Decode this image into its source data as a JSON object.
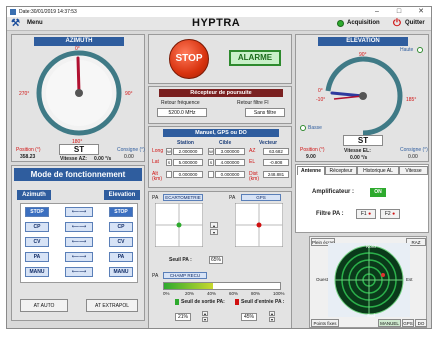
{
  "window": {
    "title": "Date:30/01/2019 14:37:53",
    "min": "–",
    "max": "□",
    "close": "✕"
  },
  "toolbar": {
    "menu": "Menu",
    "app_title": "HYPTRA",
    "acquisition": "Acquisition",
    "quit": "Quitter"
  },
  "azimuth": {
    "title": "AZIMUTH",
    "dial_0": "0°",
    "dial_90": "90°",
    "dial_180": "180°",
    "dial_270": "270°",
    "status": "ST",
    "position_label": "Position (°)",
    "position": "358.23",
    "speed_label": "Vitesse AZ:",
    "speed": "0.00 °/s",
    "setpoint_label": "Consigne (°)",
    "setpoint": "0.00"
  },
  "stop": {
    "label": "STOP",
    "alarm": "ALARME"
  },
  "receiver": {
    "title": "Récepteur de poursuite",
    "freq_label": "Retour fréquence",
    "freq": "5200.0 MHz",
    "filter_label": "Retour filtre FI",
    "filter": "Sans filtre"
  },
  "manual": {
    "title": "Manuel, GPS ou DO",
    "col_station": "Station",
    "col_cible": "Cible",
    "col_vecteur": "Vecteur",
    "rows": [
      {
        "label": "Long",
        "s_dir": "W",
        "station": "2.000000",
        "c_dir": "W",
        "cible": "3.000000",
        "v_label": "AZ",
        "vecteur": "63.682"
      },
      {
        "label": "Lat",
        "s_dir": "S",
        "station": "5.000000",
        "c_dir": "S",
        "cible": "4.000000",
        "v_label": "EL",
        "vecteur": "-0.808"
      },
      {
        "label": "Alt (km)",
        "s_dir": "",
        "station": "0.000000",
        "c_dir": "",
        "cible": "0.000000",
        "v_label": "Dist (km)",
        "vecteur": "248.881"
      }
    ]
  },
  "elevation": {
    "title": "ELEVATION",
    "haute": "Haute",
    "basse": "Basse",
    "dial_90": "90°",
    "dial_0": "0°",
    "dial_m10": "-10°",
    "dial_185": "185°",
    "status": "ST",
    "position_label": "Position (°)",
    "position": "9.00",
    "speed_label": "Vitesse EL:",
    "speed": "0.00 °/s",
    "setpoint_label": "Consigne (°)",
    "setpoint": "0.00"
  },
  "tabs": {
    "antenne": "Antenne",
    "recepteur": "Récepteur",
    "historique": "Historique AL",
    "vitesse": "Vitesse"
  },
  "antenne": {
    "ampli_label": "Amplificateur :",
    "ampli_state": "ON",
    "filter_label": "Filtre PA :",
    "f1": "F1",
    "f2": "F2"
  },
  "mode": {
    "title": "Mode de fonctionnement",
    "azimuth": "Azimuth",
    "elevation": "Elevation",
    "items": [
      "STOP",
      "CP",
      "CV",
      "PA",
      "MANU"
    ],
    "arrow": "⟵⟶",
    "auto": "AT AUTO",
    "extrapol": "AT EXTRAPOL"
  },
  "pa": {
    "pa1": "PA",
    "ecartometrie": "ECARTOMETRIE",
    "pa2": "PA",
    "gps": "GPS",
    "seuil_label": "Seuil PA :",
    "seuil": "65%",
    "pa3": "PA",
    "champ": "CHAMP RECU",
    "ticks": [
      "0%",
      "20%",
      "40%",
      "60%",
      "80%",
      "100%"
    ],
    "level": 0.42,
    "sortie_label": "Seuil de sortie PA:",
    "entree_label": "Seuil d'entrée PA :",
    "sortie": "21%",
    "entree": "45%"
  },
  "radar": {
    "plein": "Plein écran",
    "raz": "RAZ",
    "nord": "Nord",
    "est": "Est",
    "ouest": "Ouest",
    "sud": "Sud",
    "points": "Points fixes",
    "manuel": "MANUEL",
    "gps": "GPS",
    "do": "DO"
  }
}
